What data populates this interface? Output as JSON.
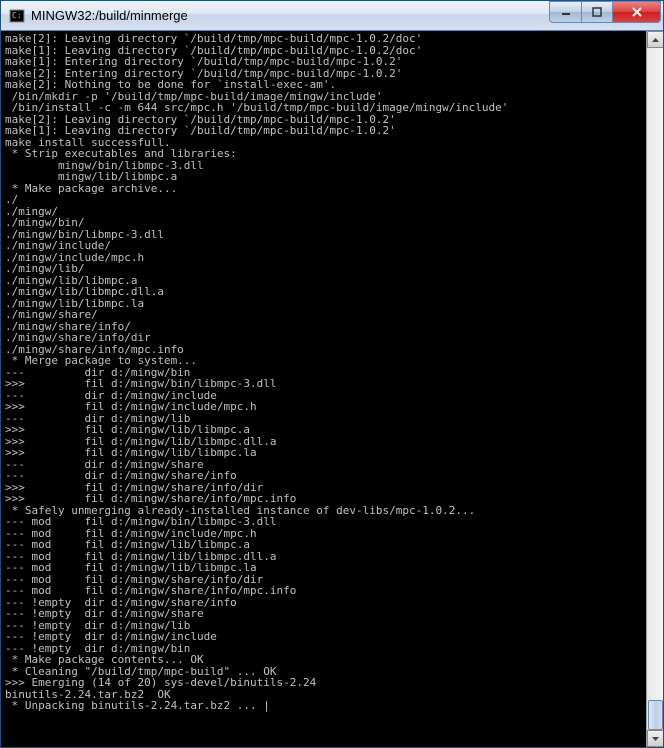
{
  "window": {
    "title": "MINGW32:/build/minmerge"
  },
  "terminal": {
    "lines": [
      "make[2]: Leaving directory `/build/tmp/mpc-build/mpc-1.0.2/doc'",
      "make[1]: Leaving directory `/build/tmp/mpc-build/mpc-1.0.2/doc'",
      "make[1]: Entering directory `/build/tmp/mpc-build/mpc-1.0.2'",
      "make[2]: Entering directory `/build/tmp/mpc-build/mpc-1.0.2'",
      "make[2]: Nothing to be done for `install-exec-am'.",
      " /bin/mkdir -p '/build/tmp/mpc-build/image/mingw/include'",
      " /bin/install -c -m 644 src/mpc.h '/build/tmp/mpc-build/image/mingw/include'",
      "make[2]: Leaving directory `/build/tmp/mpc-build/mpc-1.0.2'",
      "make[1]: Leaving directory `/build/tmp/mpc-build/mpc-1.0.2'",
      "make install successfull.",
      " * Strip executables and libraries:",
      "        mingw/bin/libmpc-3.dll",
      "        mingw/lib/libmpc.a",
      " * Make package archive...",
      "./",
      "./mingw/",
      "./mingw/bin/",
      "./mingw/bin/libmpc-3.dll",
      "./mingw/include/",
      "./mingw/include/mpc.h",
      "./mingw/lib/",
      "./mingw/lib/libmpc.a",
      "./mingw/lib/libmpc.dll.a",
      "./mingw/lib/libmpc.la",
      "./mingw/share/",
      "./mingw/share/info/",
      "./mingw/share/info/dir",
      "./mingw/share/info/mpc.info",
      " * Merge package to system...",
      "---         dir d:/mingw/bin",
      ">>>         fil d:/mingw/bin/libmpc-3.dll",
      "---         dir d:/mingw/include",
      ">>>         fil d:/mingw/include/mpc.h",
      "---         dir d:/mingw/lib",
      ">>>         fil d:/mingw/lib/libmpc.a",
      ">>>         fil d:/mingw/lib/libmpc.dll.a",
      ">>>         fil d:/mingw/lib/libmpc.la",
      "---         dir d:/mingw/share",
      "---         dir d:/mingw/share/info",
      ">>>         fil d:/mingw/share/info/dir",
      ">>>         fil d:/mingw/share/info/mpc.info",
      " * Safely unmerging already-installed instance of dev-libs/mpc-1.0.2...",
      "--- mod     fil d:/mingw/bin/libmpc-3.dll",
      "--- mod     fil d:/mingw/include/mpc.h",
      "--- mod     fil d:/mingw/lib/libmpc.a",
      "--- mod     fil d:/mingw/lib/libmpc.dll.a",
      "--- mod     fil d:/mingw/lib/libmpc.la",
      "--- mod     fil d:/mingw/share/info/dir",
      "--- mod     fil d:/mingw/share/info/mpc.info",
      "--- !empty  dir d:/mingw/share/info",
      "--- !empty  dir d:/mingw/share",
      "--- !empty  dir d:/mingw/lib",
      "--- !empty  dir d:/mingw/include",
      "--- !empty  dir d:/mingw/bin",
      " * Make package contents... OK",
      " * Cleaning \"/build/tmp/mpc-build\" ... OK",
      ">>> Emerging (14 of 20) sys-devel/binutils-2.24",
      "binutils-2.24.tar.bz2  OK",
      " * Unpacking binutils-2.24.tar.bz2 ... |"
    ]
  }
}
